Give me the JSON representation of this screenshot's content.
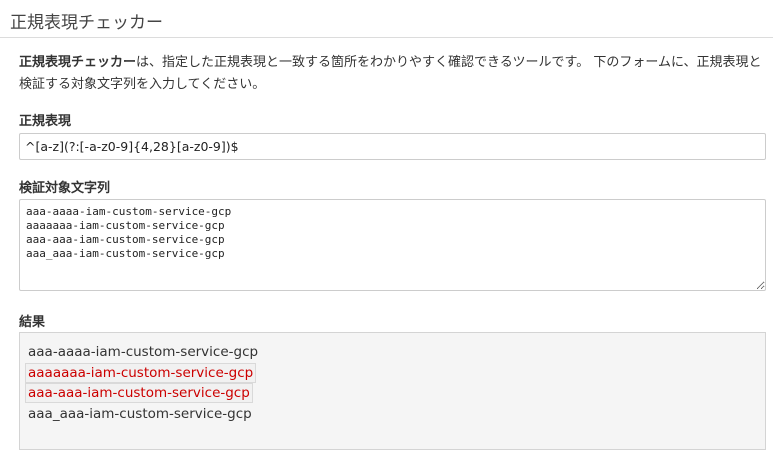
{
  "header": {
    "title": "正規表現チェッカー"
  },
  "intro": {
    "strong": "正規表現チェッカー",
    "text": "は、指定した正規表現と一致する箇所をわかりやすく確認できるツールです。 下のフォームに、正規表現と検証する対象文字列を入力してください。"
  },
  "regex": {
    "label": "正規表現",
    "value": "^[a-z](?:[-a-z0-9]{4,28}[a-z0-9])$"
  },
  "target": {
    "label": "検証対象文字列",
    "value": "aaa-aaaa-iam-custom-service-gcp\naaaaaaa-iam-custom-service-gcp\naaa-aaa-iam-custom-service-gcp\naaa_aaa-iam-custom-service-gcp"
  },
  "result": {
    "label": "結果",
    "match_color": "#cc0000",
    "lines": [
      {
        "text": "aaa-aaaa-iam-custom-service-gcp",
        "matched": false
      },
      {
        "text": "aaaaaaa-iam-custom-service-gcp",
        "matched": true
      },
      {
        "text": "aaa-aaa-iam-custom-service-gcp",
        "matched": true
      },
      {
        "text": "aaa_aaa-iam-custom-service-gcp",
        "matched": false
      }
    ]
  }
}
